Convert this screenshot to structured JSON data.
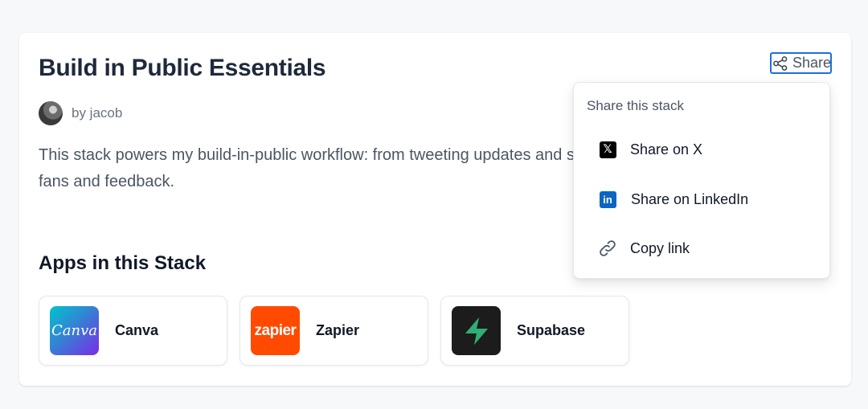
{
  "stack": {
    "title": "Build in Public Essentials",
    "author": "by jacob",
    "description_line1": "This stack powers my build-in-public workflow: from tweeting updates and s",
    "description_line2": "fans and feedback.",
    "apps_section_title": "Apps in this Stack"
  },
  "apps": [
    {
      "name": "Canva",
      "logo_text": "Canva",
      "color": "#7d2ae8"
    },
    {
      "name": "Zapier",
      "logo_text": "zapier",
      "color": "#ff4a00"
    },
    {
      "name": "Supabase",
      "color": "#3ecf8e"
    }
  ],
  "share": {
    "button_label": "Share",
    "button_icon": "share-icon",
    "accent": "#1d6fe0",
    "menu": {
      "header": "Share this stack",
      "items": [
        {
          "label": "Share on X",
          "icon": "x-logo-icon"
        },
        {
          "label": "Share on LinkedIn",
          "icon": "linkedin-icon"
        },
        {
          "label": "Copy link",
          "icon": "link-icon"
        }
      ]
    }
  }
}
